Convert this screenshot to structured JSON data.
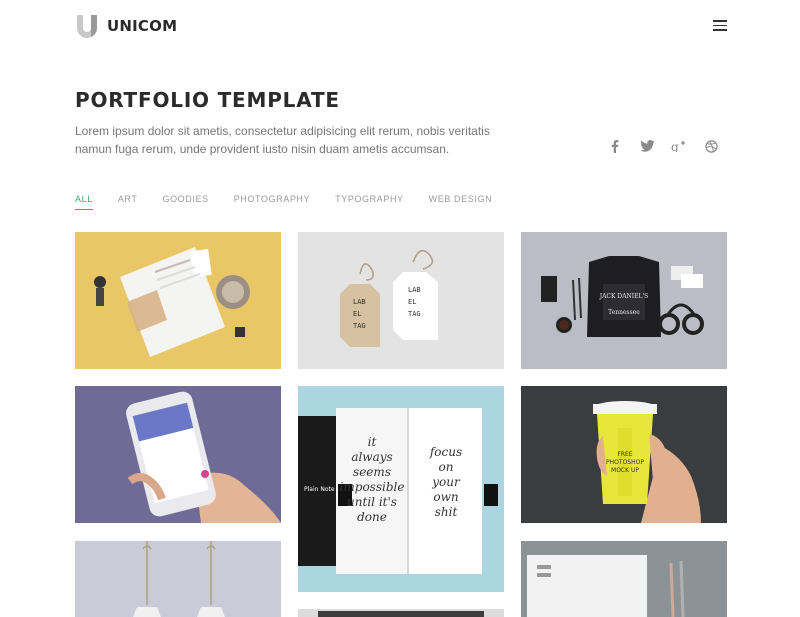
{
  "brand": {
    "name": "UNICOM"
  },
  "hero": {
    "title": "PORTFOLIO TEMPLATE",
    "intro": "Lorem ipsum dolor sit ametis, consectetur adipisicing elit rerum, nobis veritatis namun fuga rerum, unde provident iusto nisin duam ametis accumsan."
  },
  "social": [
    {
      "icon": "facebook-icon"
    },
    {
      "icon": "twitter-icon"
    },
    {
      "icon": "google-plus-icon"
    },
    {
      "icon": "dribbble-icon"
    }
  ],
  "filters": [
    {
      "label": "ALL",
      "active": true
    },
    {
      "label": "ART"
    },
    {
      "label": "GOODIES"
    },
    {
      "label": "PHOTOGRAPHY"
    },
    {
      "label": "TYPOGRAPHY"
    },
    {
      "label": "WEB DESIGN"
    }
  ],
  "portfolio": {
    "tag_text": [
      "LAB",
      "EL",
      "TAG"
    ],
    "plain_notebook": "Plain Note",
    "notebook_left": [
      "it",
      "always",
      "seems",
      "impossible",
      "until it's",
      "done"
    ],
    "notebook_right": [
      "focus",
      "on",
      "your",
      "own",
      "shit"
    ],
    "cup_text": [
      "FREE",
      "PHOTOSHOP",
      "MOCK UP"
    ],
    "shirt_text": [
      "JACK DANIEL'S",
      "Tennessee"
    ]
  },
  "colors": {
    "accent": "#2db36a",
    "tile_stationery": "#e9c766",
    "tile_tags": "#e3e3e3",
    "tile_shirt": "#bcbcc6",
    "tile_phone": "#6f6a96",
    "tile_notebook": "#a9d6df",
    "tile_cup": "#3a3d40",
    "tile_labels": "#c9ccd8",
    "tile_envelope": "#8c9396"
  }
}
